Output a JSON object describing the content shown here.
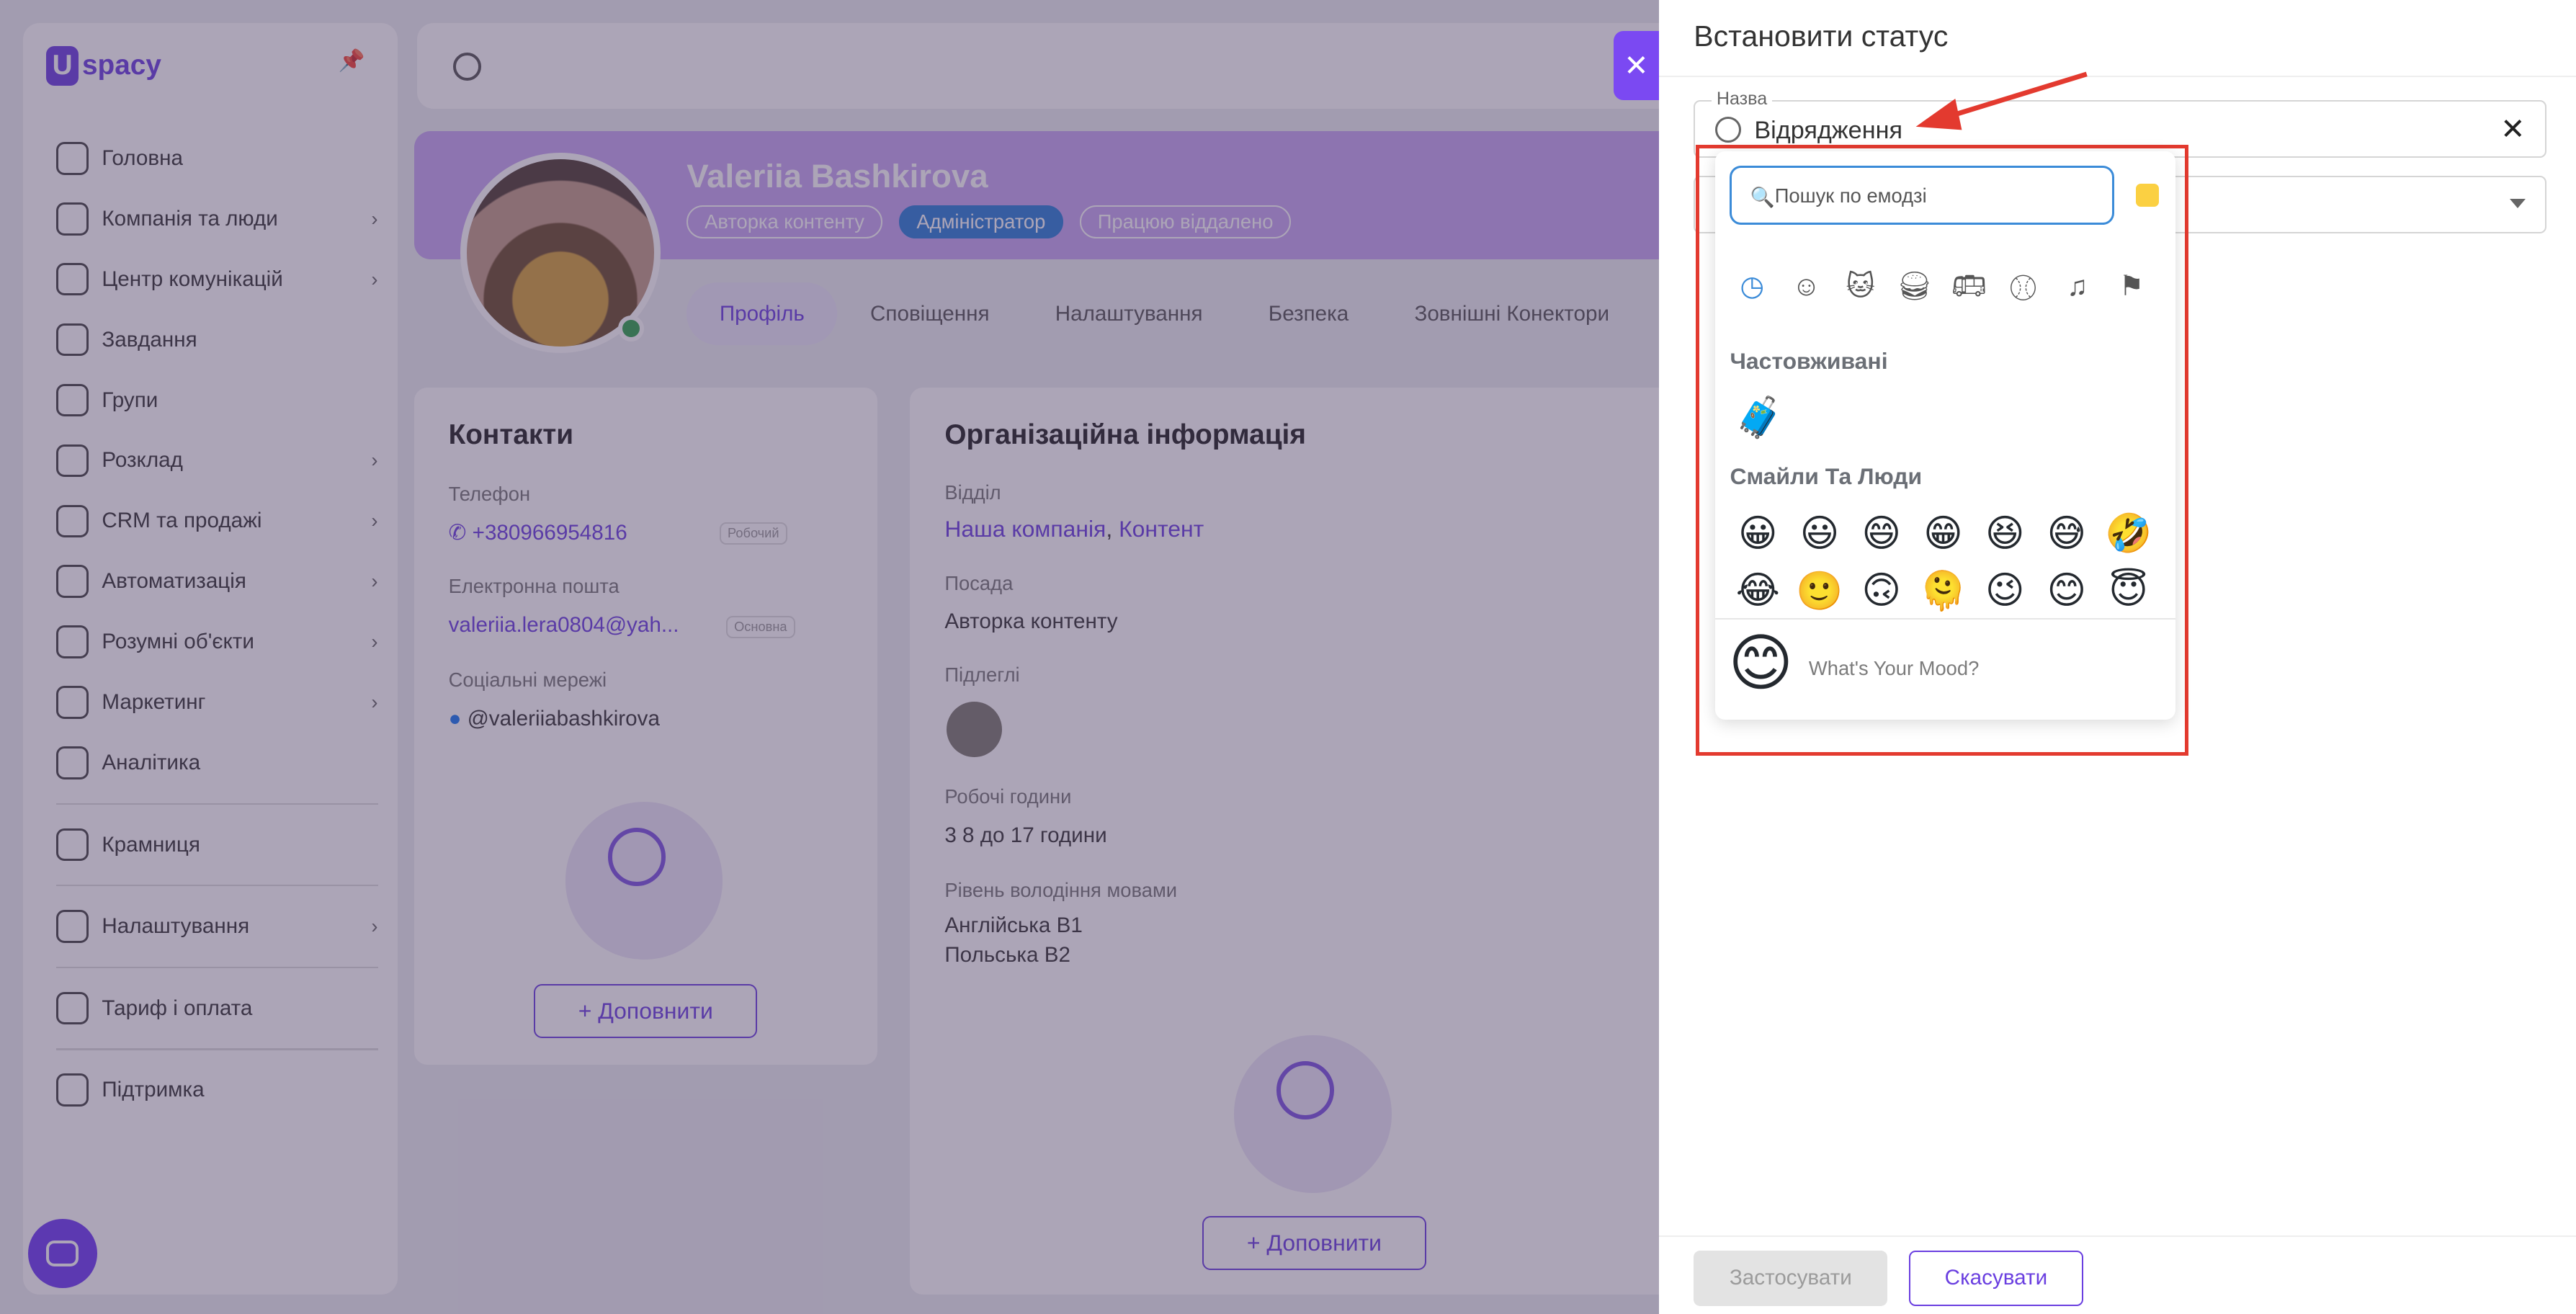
{
  "logo": {
    "text": "spacy"
  },
  "sidebar": {
    "items": [
      {
        "label": "Головна",
        "icon": "home-icon",
        "chev": false
      },
      {
        "label": "Компанія та люди",
        "icon": "building-icon",
        "chev": true
      },
      {
        "label": "Центр комунікацій",
        "icon": "chat-icon",
        "chev": true
      },
      {
        "label": "Завдання",
        "icon": "check-icon",
        "chev": false
      },
      {
        "label": "Групи",
        "icon": "users-icon",
        "chev": false
      },
      {
        "label": "Розклад",
        "icon": "calendar-icon",
        "chev": true
      },
      {
        "label": "CRM та продажі",
        "icon": "database-icon",
        "chev": true
      },
      {
        "label": "Автоматизація",
        "icon": "bolt-icon",
        "chev": true
      },
      {
        "label": "Розумні об'єкти",
        "icon": "object-icon",
        "chev": true
      },
      {
        "label": "Маркетинг",
        "icon": "marketing-icon",
        "chev": true
      },
      {
        "label": "Аналітика",
        "icon": "analytics-icon",
        "chev": false
      },
      {
        "label": "Крамниця",
        "icon": "store-icon",
        "chev": false
      },
      {
        "label": "Налаштування",
        "icon": "gear-icon",
        "chev": true
      },
      {
        "label": "Тариф і оплата",
        "icon": "wallet-icon",
        "chev": false
      },
      {
        "label": "Підтримка",
        "icon": "help-icon",
        "chev": false
      }
    ]
  },
  "profile": {
    "name": "Valeriia Bashkirova",
    "badge_role": "Авторка контенту",
    "badge_admin": "Адміністратор",
    "badge_status": "Працюю віддалено",
    "tabs": [
      "Профіль",
      "Сповіщення",
      "Налаштування",
      "Безпека",
      "Зовнішні Конектори"
    ]
  },
  "contacts": {
    "title": "Контакти",
    "phone_label": "Телефон",
    "phone": "+380966954816",
    "phone_tag": "Робочий",
    "email_label": "Електронна пошта",
    "email": "valeriia.lera0804@yah...",
    "email_tag": "Основна",
    "social_label": "Соціальні мережі",
    "social": "@valeriiabashkirova",
    "add_button": "+ Доповнити"
  },
  "org": {
    "title": "Організаційна інформація",
    "dept_label": "Відділ",
    "dept_1": "Наша компанія",
    "dept_sep": ",",
    "dept_2": "Контент",
    "position_label": "Посада",
    "position": "Авторка контенту",
    "subordinates_label": "Підлеглі",
    "hours_label": "Робочі години",
    "hours": "3 8 до 17 години",
    "lang_label": "Рівень володіння мовами",
    "lang_1": "Англійська B1",
    "lang_2": "Польська B2",
    "add_button": "+ Доповнити"
  },
  "status_panel": {
    "title": "Встановити статус",
    "field_label": "Назва",
    "field_value": "Відрядження",
    "apply": "Застосувати",
    "cancel": "Скасувати"
  },
  "picker": {
    "search_placeholder": "Пошук по емодзі",
    "categories": [
      "recent-icon",
      "smiley-icon",
      "cat-icon",
      "food-icon",
      "bus-icon",
      "ball-icon",
      "music-icon",
      "flag-icon"
    ],
    "frequent_title": "Частовживані",
    "frequent": [
      "🧳"
    ],
    "people_title": "Смайли Та Люди",
    "emojis": [
      "😀",
      "😃",
      "😄",
      "😁",
      "😆",
      "😅",
      "🤣",
      "😂",
      "🙂",
      "🙃",
      "🫠",
      "😉",
      "😊",
      "😇"
    ],
    "mood_emoji": "😊",
    "mood_text": "What's Your Mood?"
  },
  "colors": {
    "accent": "#6a3fe0",
    "annotation": "#e33a2f"
  }
}
